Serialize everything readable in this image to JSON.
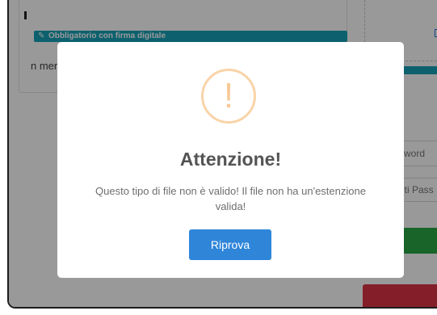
{
  "background": {
    "tag_label": "Obbligatorio con firma digitale",
    "tag_icon": "pen-icon",
    "left_text": "n merit",
    "password_placeholder": "sword",
    "forgot_placeholder": "eti Pass"
  },
  "modal": {
    "icon": "warning-icon",
    "icon_glyph": "!",
    "title": "Attenzione!",
    "message": "Questo tipo di file non è valido! Il file non ha un'estenzione valida!",
    "button_label": "Riprova"
  },
  "colors": {
    "accent_teal": "#17a2b8",
    "button_blue": "#2f86d9",
    "warning_orange": "#f8d4a8",
    "success_green": "#28a745",
    "danger_red": "#dc3545"
  }
}
